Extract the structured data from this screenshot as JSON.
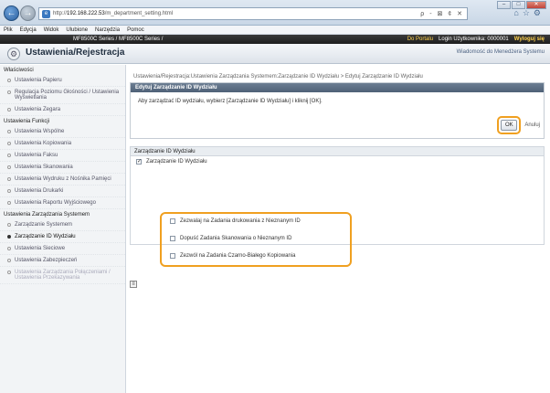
{
  "browser": {
    "url_prefix": "http://",
    "url_host": "192.168.222.53",
    "url_path": "/m_department_setting.html",
    "addr_controls": "ρ - ⊠ ¢ ✕",
    "menu": [
      "Plik",
      "Edycja",
      "Widok",
      "Ulubione",
      "Narzędzia",
      "Pomoc"
    ]
  },
  "header": {
    "model": "MF8500C Series / MF8500C Series /",
    "portal_link": "Do Portalu",
    "user_label": "Login Użytkownika: 0000001",
    "logout": "Wyloguj się"
  },
  "title": {
    "text": "Ustawienia/Rejestracja",
    "mail_admin": "Wiadomość do Menedżera Systemu"
  },
  "sidebar": {
    "sections": [
      {
        "label": "Właściwości",
        "items": [
          {
            "label": "Ustawienia Papieru",
            "state": "normal"
          },
          {
            "label": "Regulacja Poziomu Głośności / Ustawienia Wyświetlania",
            "state": "normal"
          },
          {
            "label": "Ustawienia Zegara",
            "state": "normal"
          }
        ]
      },
      {
        "label": "Ustawienia Funkcji",
        "items": [
          {
            "label": "Ustawienia Wspólne",
            "state": "normal"
          },
          {
            "label": "Ustawienia Kopiowania",
            "state": "normal"
          },
          {
            "label": "Ustawienia Faksu",
            "state": "normal"
          },
          {
            "label": "Ustawienia Skanowania",
            "state": "normal"
          },
          {
            "label": "Ustawienia Wydruku z Nośnika Pamięci",
            "state": "normal"
          },
          {
            "label": "Ustawienia Drukarki",
            "state": "normal"
          },
          {
            "label": "Ustawienia Raportu Wyjściowego",
            "state": "normal"
          }
        ]
      },
      {
        "label": "Ustawienia Zarządzania Systemem",
        "items": [
          {
            "label": "Zarządzanie Systemem",
            "state": "normal"
          },
          {
            "label": "Zarządzanie ID Wydziału",
            "state": "active"
          },
          {
            "label": "Ustawienia Sieciowe",
            "state": "normal"
          },
          {
            "label": "Ustawienia Zabezpieczeń",
            "state": "normal"
          },
          {
            "label": "Ustawienia Zarządzania Połączeniami / Ustawienia Przekazywania",
            "state": "disabled"
          }
        ]
      }
    ]
  },
  "breadcrumb": "Ustawienia/Rejestracja:Ustawienia Zarządzania Systemem:Zarządzanie ID Wydziału > Edytuj Zarządzanie ID Wydziału",
  "edit_panel": {
    "title": "Edytuj Zarządzanie ID Wydziału",
    "instructions": "Aby zarządzać ID wydziału, wybierz [Zarządzanie ID Wydziału] i kliknij [OK].",
    "ok_label": "OK",
    "cancel_label": "Anuluj"
  },
  "settings": {
    "section_title": "Zarządzanie ID Wydziału",
    "main_option": {
      "label": "Zarządzanie ID Wydziału",
      "checked": true
    },
    "options": [
      {
        "label": "Zezwalaj na Zadania drukowania z Nieznanym ID",
        "checked": false
      },
      {
        "label": "Dopuść Zadania Skanowania o Nieznanym ID",
        "checked": false
      },
      {
        "label": "Zezwól na Zadania Czarno-Białego Kopiowania",
        "checked": false
      }
    ]
  },
  "icons": {
    "back": "back-arrow-icon",
    "forward": "forward-arrow-icon",
    "title": "settings-icon",
    "collapse": "collapse-icon"
  }
}
